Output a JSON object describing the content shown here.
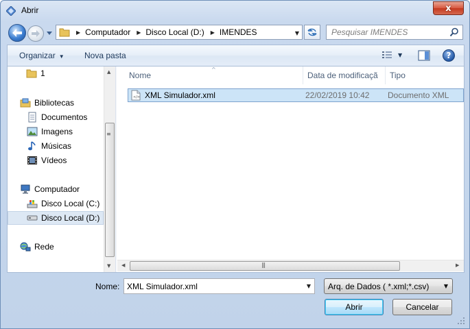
{
  "window": {
    "title": "Abrir",
    "close_label": "x"
  },
  "address_bar": {
    "breadcrumbs": [
      "Computador",
      "Disco Local (D:)",
      "IMENDES"
    ]
  },
  "search": {
    "placeholder": "Pesquisar IMENDES"
  },
  "toolbar": {
    "organize_label": "Organizar",
    "new_folder_label": "Nova pasta"
  },
  "nav_pane": {
    "items": [
      {
        "label": "1",
        "icon": "folder-icon"
      },
      {
        "label": "Bibliotecas",
        "icon": "libraries-icon"
      },
      {
        "label": "Documentos",
        "icon": "documents-icon"
      },
      {
        "label": "Imagens",
        "icon": "pictures-icon"
      },
      {
        "label": "Músicas",
        "icon": "music-icon"
      },
      {
        "label": "Vídeos",
        "icon": "videos-icon"
      },
      {
        "label": "Computador",
        "icon": "computer-icon"
      },
      {
        "label": "Disco Local (C:)",
        "icon": "system-drive-icon"
      },
      {
        "label": "Disco Local (D:)",
        "icon": "drive-icon"
      },
      {
        "label": "Rede",
        "icon": "network-icon"
      }
    ],
    "selected": "Disco Local (D:)"
  },
  "file_list": {
    "columns": [
      "Nome",
      "Data de modificaçã",
      "Tipo"
    ],
    "rows": [
      {
        "name": "XML Simulador.xml",
        "date": "22/02/2019 10:42",
        "type": "Documento XML",
        "icon": "xml-file-icon"
      }
    ]
  },
  "bottom": {
    "name_label": "Nome:",
    "name_value": "XML Simulador.xml",
    "filter_value": "Arq. de Dados ( *.xml;*.csv)",
    "open_label": "Abrir",
    "cancel_label": "Cancelar"
  },
  "colors": {
    "accent": "#3c7fb1",
    "selection": "#cce4f7",
    "close": "#c4391f"
  }
}
